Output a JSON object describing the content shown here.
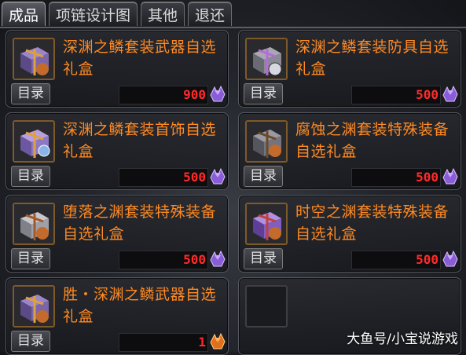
{
  "tabs": [
    {
      "label": "成品"
    },
    {
      "label": "项链设计图"
    },
    {
      "label": "其他"
    },
    {
      "label": "退还"
    }
  ],
  "catalog_button_label": "目录",
  "items": [
    {
      "name": "深渊之鳞套装武器自选礼盒",
      "price": "900",
      "icon": "gift-box-icon"
    },
    {
      "name": "深渊之鳞套装防具自选礼盒",
      "price": "500",
      "icon": "gift-box-icon"
    },
    {
      "name": "深渊之鳞套装首饰自选礼盒",
      "price": "500",
      "icon": "gift-box-icon"
    },
    {
      "name": "腐蚀之渊套装特殊装备自选礼盒",
      "price": "500",
      "icon": "gift-box-icon"
    },
    {
      "name": "堕落之渊套装特殊装备自选礼盒",
      "price": "500",
      "icon": "gift-box-icon"
    },
    {
      "name": "时空之渊套装特殊装备自选礼盒",
      "price": "500",
      "icon": "gift-box-icon"
    },
    {
      "name": "胜・深渊之鳞武器自选礼盒",
      "price": "1",
      "icon": "gift-box-icon"
    }
  ],
  "currency_icon": "purple-crystal-icon",
  "watermark": "大鱼号/小宝说游戏",
  "colors": {
    "item_name": "#ff8a22",
    "price": "#ff2a2a",
    "crystal": "#8a5cd6"
  }
}
